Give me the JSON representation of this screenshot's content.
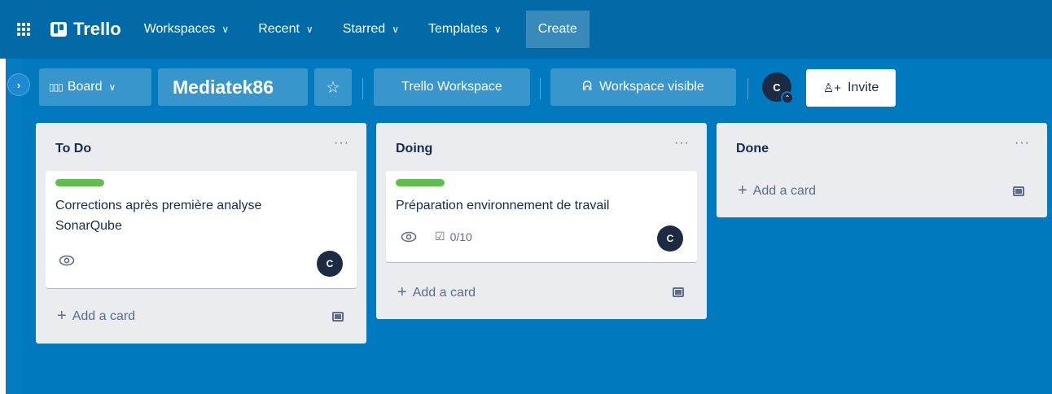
{
  "topnav": {
    "logo": "Trello",
    "items": [
      {
        "label": "Workspaces"
      },
      {
        "label": "Recent"
      },
      {
        "label": "Starred"
      },
      {
        "label": "Templates"
      }
    ],
    "create_label": "Create"
  },
  "board_header": {
    "view_label": "Board",
    "title": "Mediatek86",
    "workspace_label": "Trello Workspace",
    "visibility_label": "Workspace visible",
    "avatar_initial": "C",
    "invite_label": "Invite"
  },
  "lists": [
    {
      "title": "To Do",
      "menu": "···",
      "cards": [
        {
          "label_color": "#61bd4f",
          "title_line1": "Corrections après première analyse",
          "title_line2": "SonarQube",
          "watching": true,
          "member": "C"
        }
      ],
      "add_card": "Add a card"
    },
    {
      "title": "Doing",
      "menu": "···",
      "cards": [
        {
          "label_color": "#61bd4f",
          "title_line1": "Préparation environnement de travail",
          "watching": true,
          "checklist": "0/10",
          "member": "C"
        }
      ],
      "add_card": "Add a card"
    },
    {
      "title": "Done",
      "menu": "···",
      "cards": [],
      "add_card": "Add a card"
    }
  ],
  "colors": {
    "nav_bg": "#026aa7",
    "board_bg": "#0079bf",
    "list_bg": "#ebecf0",
    "label_green": "#61bd4f",
    "avatar_bg": "#1c2a44"
  }
}
